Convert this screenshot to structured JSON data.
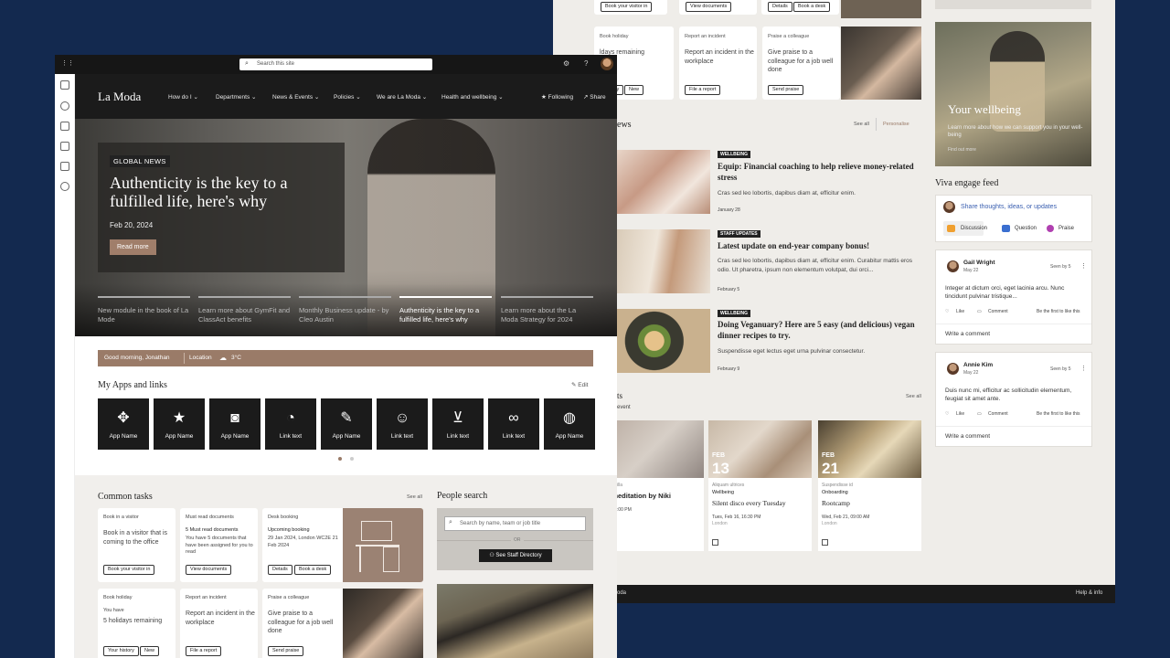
{
  "back": {
    "top_buttons": [
      "Book your visitor in",
      "View documents",
      "Details",
      "Book a desk"
    ],
    "tasks": [
      {
        "label": "Book holiday",
        "body": "ldays remaining",
        "buttons": [
          "history",
          "New"
        ]
      },
      {
        "label": "Report an incident",
        "body": "Report an incident in the workplace",
        "buttons": [
          "File a report"
        ]
      },
      {
        "label": "Praise a colleague",
        "body": "Give praise to a colleague for a job well done",
        "buttons": [
          "Send praise"
        ]
      }
    ],
    "wellbeing": {
      "title": "Your wellbeing",
      "subtitle": "Learn more about how we can support you in your well-being",
      "link": "Find out more"
    },
    "news": {
      "heading": "ews",
      "see_all": "See all",
      "personalise": "Personalise",
      "items": [
        {
          "tag": "WELLBEING",
          "title": "Equip:  Financial coaching to help relieve money-related stress",
          "text": "Cras sed leo lobortis, dapibus diam at, efficitur enim.",
          "date": "January 28"
        },
        {
          "tag": "STAFF UPDATES",
          "title": "Latest update on end-year company bonus!",
          "text": "Cras sed leo lobortis, dapibus diam at, efficitur enim. Curabitur mattis eros odio. Ut pharetra, ipsum non elementum volutpat, dui orci...",
          "date": "February 5"
        },
        {
          "tag": "WELLBEING",
          "title": "Doing Veganuary? Here are 5 easy (and delicious) vegan dinner recipes to try.",
          "text": "Suspendisse eget lectus eget urna pulvinar consectetur.",
          "date": "February 9"
        }
      ]
    },
    "events": {
      "heading": "ts",
      "sub": "event",
      "see_all": "See all",
      "items": [
        {
          "month": "",
          "day": "",
          "meta": "e fringilla",
          "category": "",
          "title": "ly meditation by Niki",
          "time": "16, 15:00 PM",
          "location": ""
        },
        {
          "month": "FEB",
          "day": "13",
          "meta": "Aliquam ultrices",
          "category": "Wellbeing",
          "title": "Silent disco every Tuesday",
          "time": "Tues, Feb 16,  16:30 PM",
          "location": "London"
        },
        {
          "month": "FEB",
          "day": "21",
          "meta": "Suspendisse id",
          "category": "Onboarding",
          "title": "Rootcamp",
          "time": "Wed, Feb 21, 09:00 AM",
          "location": "London"
        }
      ]
    },
    "engage": {
      "heading": "Viva engage feed",
      "share_placeholder": "Share thoughts, ideas, or updates",
      "actions": [
        "Discussion",
        "Question",
        "Praise"
      ],
      "posts": [
        {
          "name": "Gail Wright",
          "date": "May 22",
          "seen": "Seen by 5",
          "text": "Integer at dictum orci, eget lacinia arcu. Nunc tincidunt pulvinar tristique...",
          "like": "Like",
          "comment": "Comment",
          "first": "Be the first to like this",
          "write": "Write a comment"
        },
        {
          "name": "Annie Kim",
          "date": "May 22",
          "seen": "Seen by 5",
          "text": "Duis nunc mi, efficitur ac sollicitudin elementum, feugiat sit amet ante.",
          "like": "Like",
          "comment": "Comment",
          "first": "Be the first to like this",
          "write": "Write a comment"
        }
      ]
    },
    "footer": {
      "left": "oda",
      "right": "Help & info"
    }
  },
  "front": {
    "search_placeholder": "Search this site",
    "site_title": "La Moda",
    "nav": [
      "How do I",
      "Departments",
      "News & Events",
      "Policies",
      "We are La Moda",
      "Health and wellbeing"
    ],
    "following": "Following",
    "share": "Share",
    "hero": {
      "tag": "GLOBAL NEWS",
      "title": "Authenticity is the key to a fulfilled life, here's why",
      "date": "Feb 20, 2024",
      "button": "Read more",
      "strip": [
        "New module in the book of La Mode",
        "Learn more about GymFit and ClassAct benefits",
        "Monthly Business update - by Cleo Austin",
        "Authenticity is the key to a fulfilled life, here's why",
        "Learn more about the La Moda Strategy for 2024"
      ]
    },
    "greeting": {
      "text": "Good morning, Jonathan",
      "location": "Location",
      "temp": "3°C"
    },
    "apps": {
      "heading": "My Apps and links",
      "edit": "Edit",
      "tiles": [
        {
          "label": "App Name",
          "icon": "diamond-move-icon"
        },
        {
          "label": "App Name",
          "icon": "star-icon"
        },
        {
          "label": "App Name",
          "icon": "camera-icon"
        },
        {
          "label": "Link text",
          "icon": "timer-icon"
        },
        {
          "label": "App Name",
          "icon": "edit-screen-icon"
        },
        {
          "label": "Link text",
          "icon": "person-icon"
        },
        {
          "label": "Link text",
          "icon": "cart-icon"
        },
        {
          "label": "Link text",
          "icon": "binoculars-icon"
        },
        {
          "label": "App Name",
          "icon": "globe-icon"
        }
      ]
    },
    "common_tasks": {
      "heading": "Common tasks",
      "see_all": "See all",
      "cards": [
        {
          "label": "Book in a visitor",
          "body": "Book in a visitor that is coming to the office",
          "buttons": [
            "Book your visitor in"
          ]
        },
        {
          "label": "Must read documents",
          "sub": "5 Must read documents",
          "body": "You have 5 documents that have been assigned for you to read",
          "buttons": [
            "View documents"
          ]
        },
        {
          "label": "Desk booking",
          "sub": "Upcoming booking",
          "body": "29 Jan 2024, London WC2E 21 Feb 2024",
          "buttons": [
            "Details",
            "Book a desk"
          ]
        },
        {
          "label": "Book holiday",
          "sub": "You have",
          "body": "5 holidays remaining",
          "buttons": [
            "Your history",
            "New"
          ]
        },
        {
          "label": "Report an incident",
          "body": "Report an incident in the workplace",
          "buttons": [
            "File a report"
          ]
        },
        {
          "label": "Praise a colleague",
          "body": "Give praise to a colleague for a job well done",
          "buttons": [
            "Send praise"
          ]
        }
      ]
    },
    "people": {
      "heading": "People search",
      "placeholder": "Search by name, team or job title",
      "or": "OR",
      "button": "See Staff Directory"
    }
  }
}
